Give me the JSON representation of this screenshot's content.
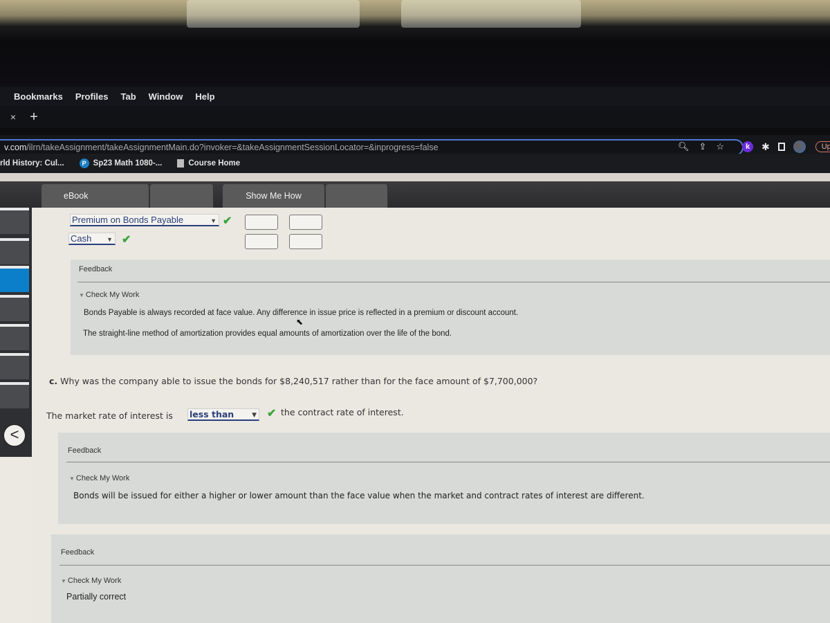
{
  "menubar": {
    "items": [
      "Bookmarks",
      "Profiles",
      "Tab",
      "Window",
      "Help"
    ]
  },
  "tabstrip": {
    "close_glyph": "×",
    "new_tab_glyph": "+"
  },
  "addressbar": {
    "host": "v.com",
    "path": "/ilrn/takeAssignment/takeAssignmentMain.do?invoker=&takeAssignmentSessionLocator=&inprogress=false",
    "icons": [
      "zoom-icon",
      "share-icon",
      "star-icon"
    ],
    "extensions": {
      "k_label": "k",
      "update_label": "Up"
    }
  },
  "bookmarks": [
    {
      "label": "rld History: Cul...",
      "icon": "none"
    },
    {
      "label": "Sp23 Math 1080-...",
      "icon": "pearson-icon",
      "icon_glyph": "P"
    },
    {
      "label": "Course Home",
      "icon": "document-icon"
    }
  ],
  "toolbar": {
    "ebook_label": "eBook",
    "show_me_how_label": "Show Me How"
  },
  "journal": {
    "rows": [
      {
        "account": "Premium on Bonds Payable",
        "correct": true
      },
      {
        "account": "Cash",
        "correct": true
      }
    ],
    "check_glyph": "✔"
  },
  "feedback1": {
    "label": "Feedback",
    "check_my_work": "Check My Work",
    "lines": [
      "Bonds Payable is always recorded at face value. Any difference in issue price is reflected in a premium or discount account.",
      "The straight-line method of amortization provides equal amounts of amortization over the life of the bond."
    ]
  },
  "question_c": {
    "prefix": "c.",
    "text": "Why was the company able to issue the bonds for $8,240,517 rather than for the face amount of $7,700,000?",
    "answer_prefix": "The market rate of interest is",
    "answer_selected": "less than",
    "answer_suffix": "the contract rate of interest.",
    "correct": true
  },
  "feedback2": {
    "label": "Feedback",
    "check_my_work": "Check My Work",
    "text": "Bonds will be issued for either a higher or lower amount than the face value when the market and contract rates of interest are different."
  },
  "feedback3": {
    "label": "Feedback",
    "check_my_work": "Check My Work",
    "status": "Partially correct"
  },
  "nav": {
    "back_glyph": "<"
  }
}
